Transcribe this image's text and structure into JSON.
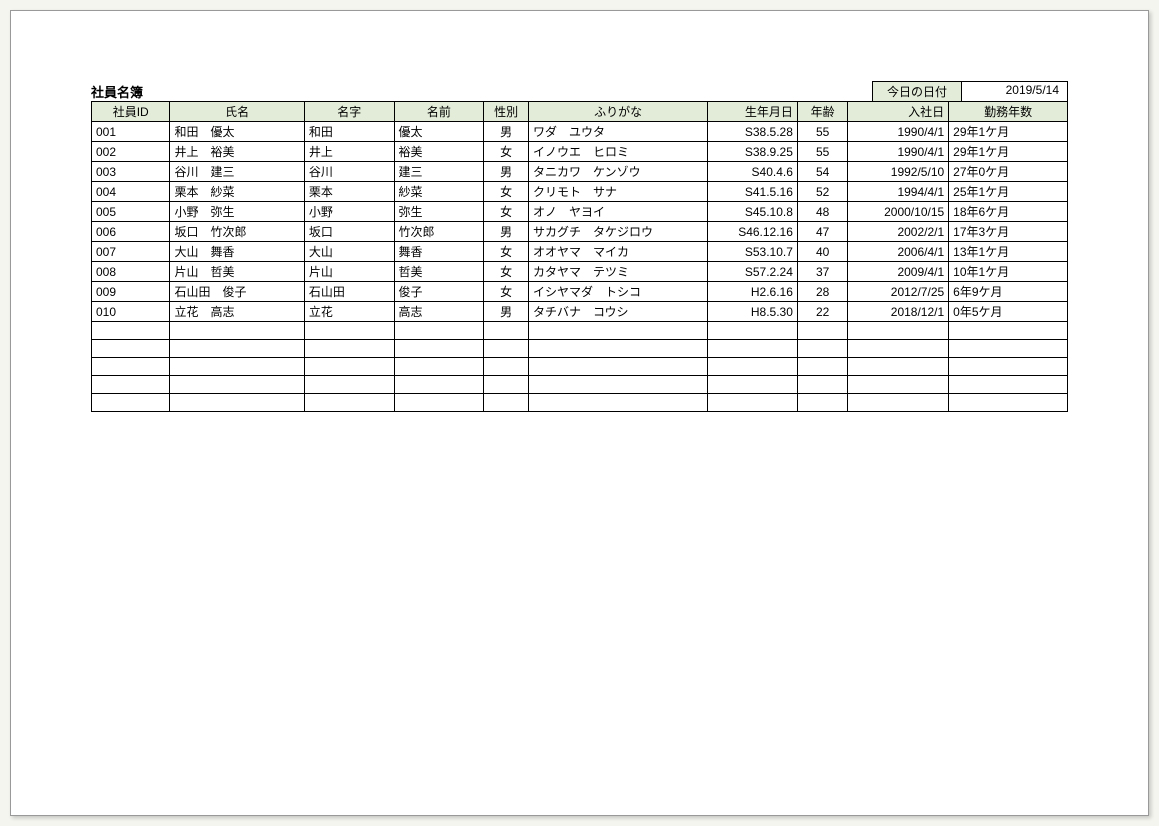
{
  "title": "社員名簿",
  "today_label": "今日の日付",
  "today_value": "2019/5/14",
  "headers": {
    "id": "社員ID",
    "name": "氏名",
    "surname": "名字",
    "given": "名前",
    "gender": "性別",
    "furigana": "ふりがな",
    "dob": "生年月日",
    "age": "年齢",
    "hire": "入社日",
    "tenure": "勤務年数"
  },
  "rows": [
    {
      "id": "001",
      "name": "和田　優太",
      "surname": "和田",
      "given": "優太",
      "gender": "男",
      "furigana": "ワダ　ユウタ",
      "dob": "S38.5.28",
      "age": "55",
      "hire": "1990/4/1",
      "tenure": "29年1ケ月"
    },
    {
      "id": "002",
      "name": "井上　裕美",
      "surname": "井上",
      "given": "裕美",
      "gender": "女",
      "furigana": "イノウエ　ヒロミ",
      "dob": "S38.9.25",
      "age": "55",
      "hire": "1990/4/1",
      "tenure": "29年1ケ月"
    },
    {
      "id": "003",
      "name": "谷川　建三",
      "surname": "谷川",
      "given": "建三",
      "gender": "男",
      "furigana": "タニカワ　ケンゾウ",
      "dob": "S40.4.6",
      "age": "54",
      "hire": "1992/5/10",
      "tenure": "27年0ケ月"
    },
    {
      "id": "004",
      "name": "栗本　紗菜",
      "surname": "栗本",
      "given": "紗菜",
      "gender": "女",
      "furigana": "クリモト　サナ",
      "dob": "S41.5.16",
      "age": "52",
      "hire": "1994/4/1",
      "tenure": "25年1ケ月"
    },
    {
      "id": "005",
      "name": "小野　弥生",
      "surname": "小野",
      "given": "弥生",
      "gender": "女",
      "furigana": "オノ　ヤヨイ",
      "dob": "S45.10.8",
      "age": "48",
      "hire": "2000/10/15",
      "tenure": "18年6ケ月"
    },
    {
      "id": "006",
      "name": "坂口　竹次郎",
      "surname": "坂口",
      "given": "竹次郎",
      "gender": "男",
      "furigana": "サカグチ　タケジロウ",
      "dob": "S46.12.16",
      "age": "47",
      "hire": "2002/2/1",
      "tenure": "17年3ケ月"
    },
    {
      "id": "007",
      "name": "大山　舞香",
      "surname": "大山",
      "given": "舞香",
      "gender": "女",
      "furigana": "オオヤマ　マイカ",
      "dob": "S53.10.7",
      "age": "40",
      "hire": "2006/4/1",
      "tenure": "13年1ケ月"
    },
    {
      "id": "008",
      "name": "片山　哲美",
      "surname": "片山",
      "given": "哲美",
      "gender": "女",
      "furigana": "カタヤマ　テツミ",
      "dob": "S57.2.24",
      "age": "37",
      "hire": "2009/4/1",
      "tenure": "10年1ケ月"
    },
    {
      "id": "009",
      "name": "石山田　俊子",
      "surname": "石山田",
      "given": "俊子",
      "gender": "女",
      "furigana": "イシヤマダ　トシコ",
      "dob": "H2.6.16",
      "age": "28",
      "hire": "2012/7/25",
      "tenure": "6年9ケ月"
    },
    {
      "id": "010",
      "name": "立花　高志",
      "surname": "立花",
      "given": "高志",
      "gender": "男",
      "furigana": "タチバナ　コウシ",
      "dob": "H8.5.30",
      "age": "22",
      "hire": "2018/12/1",
      "tenure": "0年5ケ月"
    }
  ],
  "empty_rows": 5
}
